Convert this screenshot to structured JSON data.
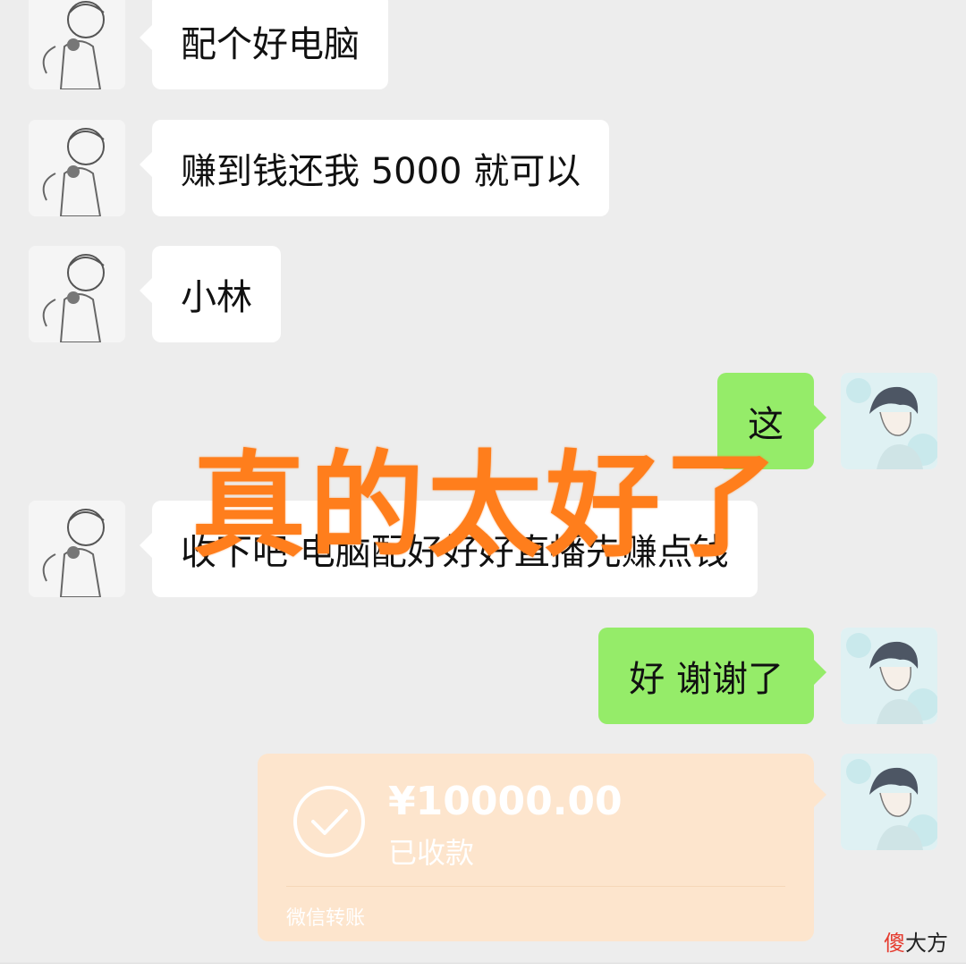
{
  "messages": [
    {
      "side": "left",
      "text": "配个好电脑"
    },
    {
      "side": "left",
      "text": "赚到钱还我 5000 就可以"
    },
    {
      "side": "left",
      "text": "小林"
    },
    {
      "side": "right",
      "text": "这"
    },
    {
      "side": "left",
      "text": "收下吧 电脑配好好好直播先赚点钱"
    },
    {
      "side": "right",
      "text": "好  谢谢了"
    }
  ],
  "transfer": {
    "amount": "¥10000.00",
    "status": "已收款",
    "label": "微信转账"
  },
  "overlay_caption": "真的太好了",
  "watermark": {
    "first_char": "傻",
    "rest": "大方"
  },
  "colors": {
    "background": "#ededed",
    "left_bubble": "#ffffff",
    "right_bubble": "#95ec69",
    "transfer_card": "#fde5cd",
    "overlay_text": "#ff7e1c"
  },
  "icons": {
    "received_check": "check-circle-icon"
  }
}
